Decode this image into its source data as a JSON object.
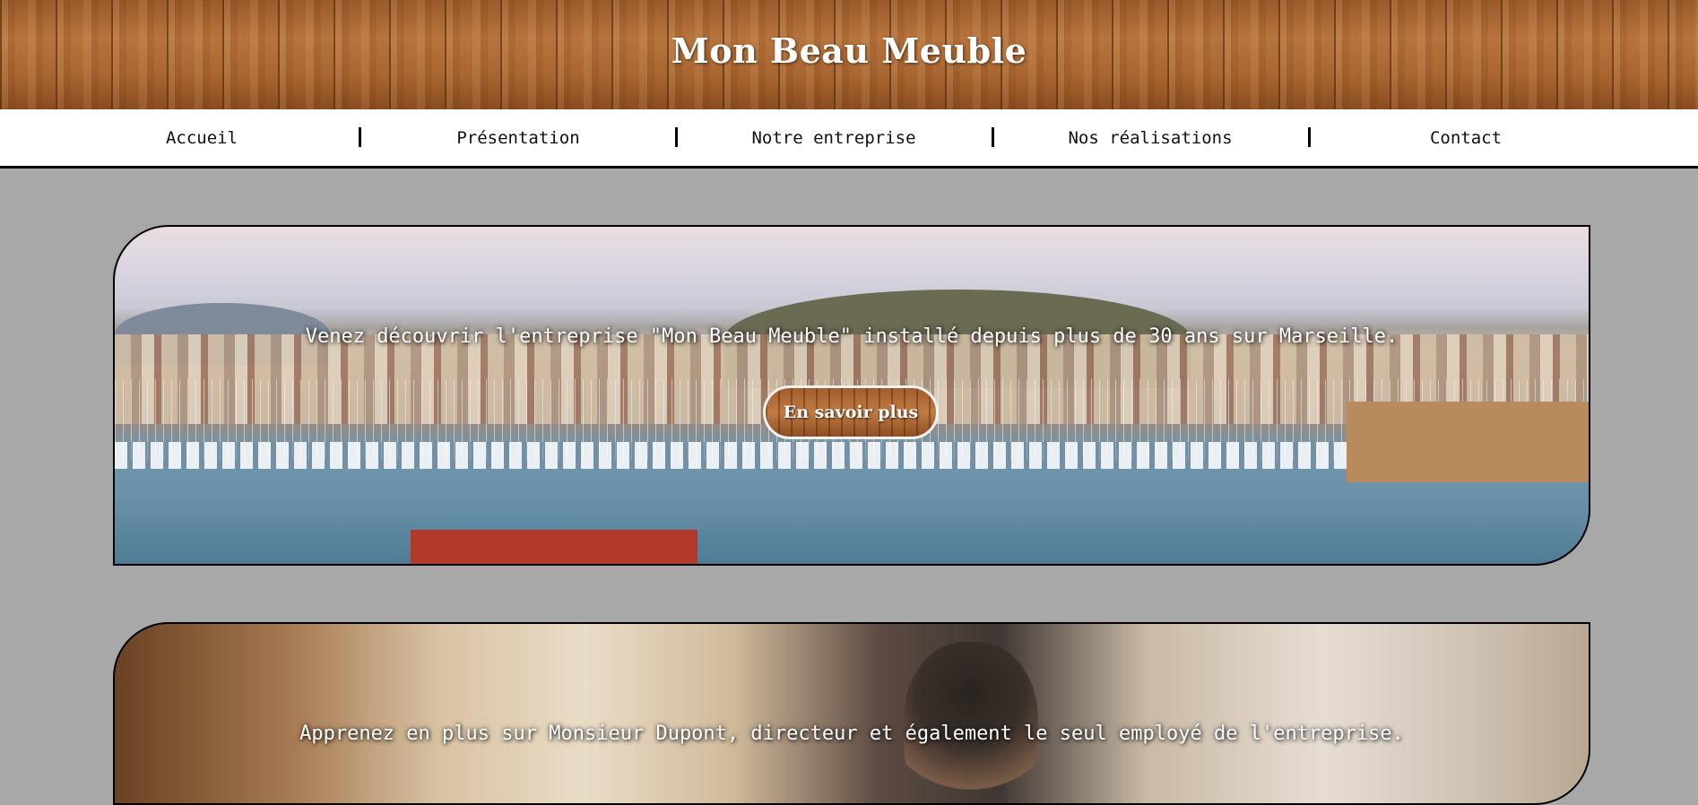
{
  "header": {
    "title": "Mon Beau Meuble"
  },
  "nav": {
    "items": [
      {
        "label": "Accueil"
      },
      {
        "label": "Présentation"
      },
      {
        "label": "Notre entreprise"
      },
      {
        "label": "Nos réalisations"
      },
      {
        "label": "Contact"
      }
    ]
  },
  "banners": [
    {
      "text": "Venez découvrir l'entreprise \"Mon Beau Meuble\" installé depuis plus de 30 ans sur Marseille.",
      "button_label": "En savoir plus"
    },
    {
      "text": "Apprenez en plus sur Monsieur Dupont, directeur et également le seul employé de l'entreprise."
    }
  ],
  "colors": {
    "page_background": "#a8a8a8",
    "nav_background": "#ffffff",
    "title_text": "#ffffff",
    "wood": "#a8652f"
  }
}
